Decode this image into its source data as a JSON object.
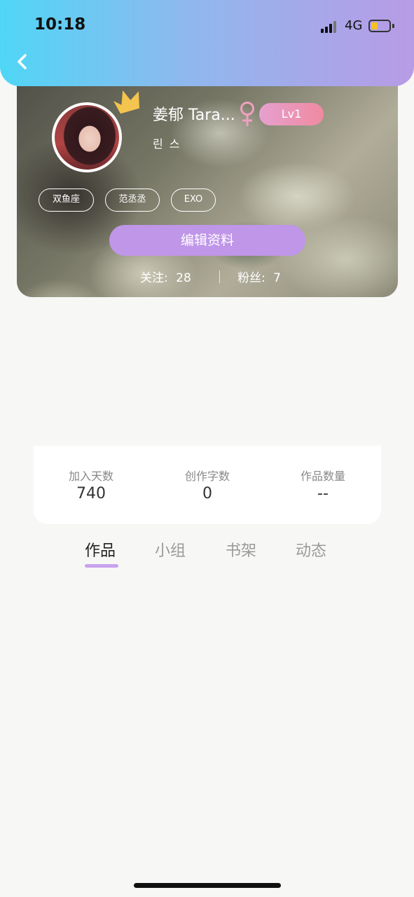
{
  "status_bar": {
    "time": "10:18",
    "network": "4G"
  },
  "profile": {
    "username": "姜郁 Tara...",
    "level": "Lv1",
    "bio": "린 스",
    "tags": [
      "双鱼座",
      "范丞丞",
      "EXO"
    ],
    "edit_label": "编辑资料",
    "following_label": "关注:",
    "following_count": "28",
    "followers_label": "粉丝:",
    "followers_count": "7"
  },
  "stats": [
    {
      "label": "加入天数",
      "value": "740"
    },
    {
      "label": "创作字数",
      "value": "0"
    },
    {
      "label": "作品数量",
      "value": "--"
    }
  ],
  "tabs": [
    {
      "label": "作品",
      "active": true
    },
    {
      "label": "小组",
      "active": false
    },
    {
      "label": "书架",
      "active": false
    },
    {
      "label": "动态",
      "active": false
    }
  ],
  "colors": {
    "header_gradient_start": "#4fd6f6",
    "header_gradient_end": "#b89be6",
    "accent_purple": "#bf96e8",
    "level_badge": "#f08aa0",
    "gender_pink": "#f0a0c0",
    "battery_fill": "#f6c022"
  },
  "icons": {
    "back": "chevron-left-icon",
    "crown": "crown-icon",
    "gender": "female-symbol-icon",
    "signal": "signal-bars-icon",
    "battery": "battery-icon"
  }
}
